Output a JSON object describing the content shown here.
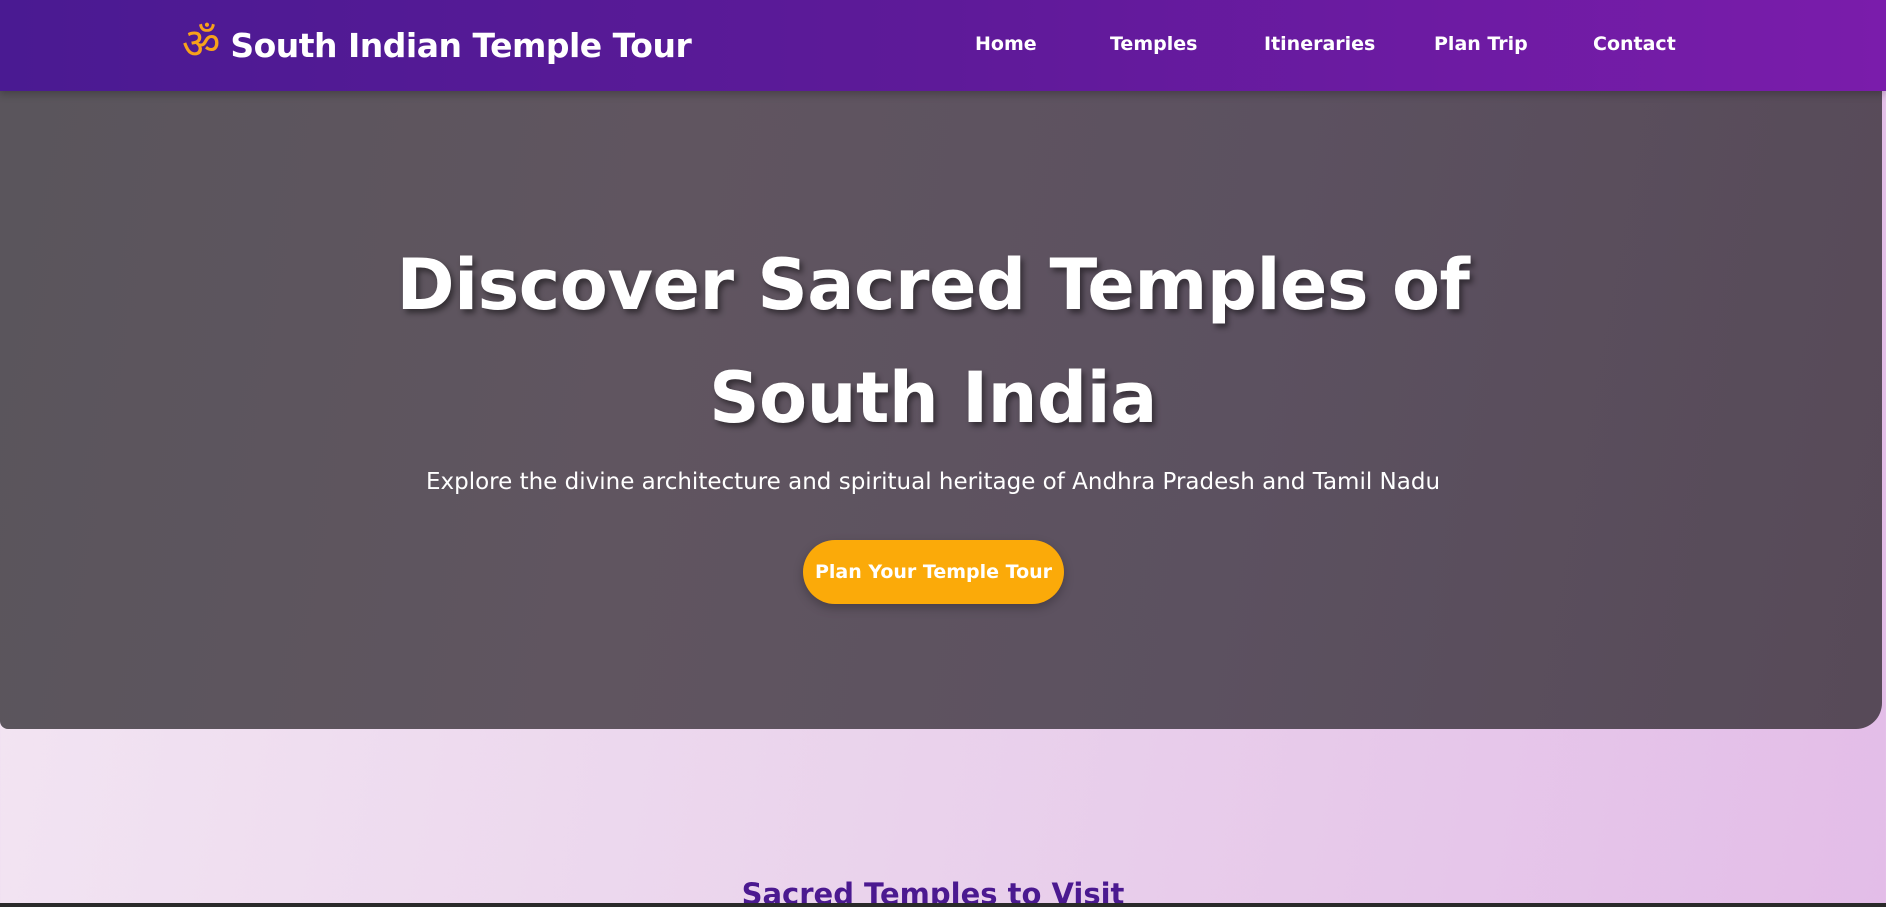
{
  "header": {
    "logo_glyph": "ॐ",
    "title": "South Indian Temple Tour",
    "nav": [
      {
        "label": "Home"
      },
      {
        "label": "Temples"
      },
      {
        "label": "Itineraries"
      },
      {
        "label": "Plan Trip"
      },
      {
        "label": "Contact"
      }
    ]
  },
  "hero": {
    "title_line1": "Discover Sacred Temples of",
    "title_line2": "South India",
    "subtitle": "Explore the divine architecture and spiritual heritage of Andhra Pradesh and Tamil Nadu",
    "cta_label": "Plan Your Temple Tour"
  },
  "temples_section": {
    "title": "Sacred Temples to Visit"
  },
  "colors": {
    "nav_start": "#4a1a92",
    "nav_end": "#7a1cab",
    "accent": "#fbaa09",
    "logo": "#f7a21b",
    "section_title": "#4b1990"
  }
}
